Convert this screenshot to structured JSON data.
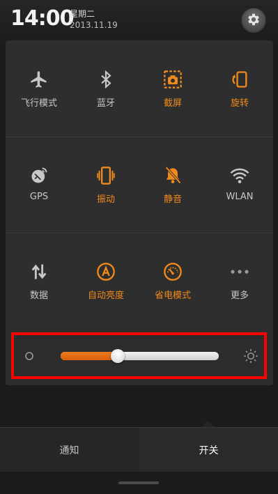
{
  "status": {
    "time": "14:00",
    "weekday": "星期二",
    "date": "2013.11.19"
  },
  "toggles": [
    {
      "label": "飞行模式",
      "icon": "airplane-icon",
      "active": false
    },
    {
      "label": "蓝牙",
      "icon": "bluetooth-icon",
      "active": false
    },
    {
      "label": "截屏",
      "icon": "screenshot-icon",
      "active": true
    },
    {
      "label": "旋转",
      "icon": "rotate-icon",
      "active": true
    },
    {
      "label": "GPS",
      "icon": "gps-icon",
      "active": false
    },
    {
      "label": "振动",
      "icon": "vibrate-icon",
      "active": true
    },
    {
      "label": "静音",
      "icon": "mute-icon",
      "active": true
    },
    {
      "label": "WLAN",
      "icon": "wifi-icon",
      "active": false
    },
    {
      "label": "数据",
      "icon": "data-icon",
      "active": false
    },
    {
      "label": "自动亮度",
      "icon": "auto-brightness-icon",
      "active": true
    },
    {
      "label": "省电模式",
      "icon": "power-saving-icon",
      "active": true
    },
    {
      "label": "更多",
      "icon": "more-icon",
      "active": false
    }
  ],
  "brightness": {
    "level": 0.36
  },
  "tabs": {
    "notify": "通知",
    "switches": "开关"
  },
  "colors": {
    "accent": "#f08a1c",
    "inactive": "#c8c8c8",
    "highlight": "#ff0000"
  }
}
